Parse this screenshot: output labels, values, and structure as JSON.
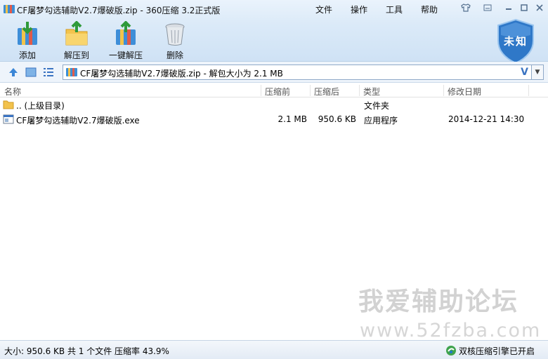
{
  "window": {
    "title": "CF屠梦勾选辅助V2.7爆破版.zip - 360压缩 3.2正式版",
    "menus": [
      "文件",
      "操作",
      "工具",
      "帮助"
    ]
  },
  "toolbar": {
    "add_label": "添加",
    "extract_to_label": "解压到",
    "one_click_extract_label": "一键解压",
    "delete_label": "删除"
  },
  "security_badge": {
    "label": "未知"
  },
  "address": {
    "path": "CF屠梦勾选辅助V2.7爆破版.zip - 解包大小为 2.1 MB",
    "v_label": "V"
  },
  "columns": {
    "name": "名称",
    "compressed_before": "压缩前",
    "compressed_after": "压缩后",
    "type": "类型",
    "modified": "修改日期"
  },
  "files": [
    {
      "name": ".. (上级目录)",
      "size_before": "",
      "size_after": "",
      "type": "文件夹",
      "modified": ""
    },
    {
      "name": "CF屠梦勾选辅助V2.7爆破版.exe",
      "size_before": "2.1 MB",
      "size_after": "950.6 KB",
      "type": "应用程序",
      "modified": "2014-12-21 14:30"
    }
  ],
  "watermark": {
    "line1": "我爱辅助论坛",
    "line2": "www.52fzba.com"
  },
  "status": {
    "text": "大小: 950.6 KB 共 1 个文件 压缩率 43.9%",
    "engine": "双核压缩引擎已开启"
  },
  "colors": {
    "accent": "#3b74c2",
    "shield": "#2f78c8",
    "header_band": "#dbeaf8"
  }
}
